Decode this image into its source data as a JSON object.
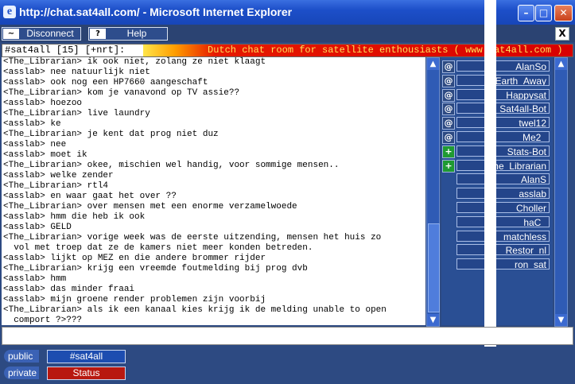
{
  "window": {
    "title": "http://chat.sat4all.com/ - Microsoft Internet Explorer",
    "title_icon": "ie-icon",
    "controls": [
      "minimize",
      "maximize",
      "close"
    ]
  },
  "toolbar": {
    "disconnect_label": "Disconnect",
    "disconnect_icon": "signal-icon",
    "help_label": "Help",
    "help_icon": "question-icon",
    "close_label": "X"
  },
  "topic": {
    "channel": "#sat4all [15] [+nrt]:",
    "text": "Dutch chat room for satellite enthousiasts ( www.sat4all.com )"
  },
  "chat": {
    "lines": [
      "<The_Librarian> ik ook niet, zolang ze niet klaagt",
      "<asslab> nee natuurlijk niet",
      "<asslab> ook nog een HP7660 aangeschaft",
      "<The_Librarian> kom je vanavond op TV assie??",
      "<asslab> hoezoo",
      "<The_Librarian> live laundry",
      "<asslab> ke",
      "<The_Librarian> je kent dat prog niet duz",
      "<asslab> nee",
      "<asslab> moet ik",
      "<The_Librarian> okee, mischien wel handig, voor sommige mensen..",
      "<asslab> welke zender",
      "<The_Librarian> rtl4",
      "<asslab> en waar gaat het over ??",
      "<The_Librarian> over mensen met een enorme verzamelwoede",
      "<asslab> hmm die heb ik ook",
      "<asslab> GELD",
      "<The_Librarian> vorige week was de eerste uitzending, mensen het huis zo",
      "  vol met troep dat ze de kamers niet meer konden betreden.",
      "<asslab> lijkt op MEZ en die andere brommer rijder",
      "<The_Librarian> krijg een vreemde foutmelding bij prog dvb",
      "<asslab> hmm",
      "<asslab> das minder fraai",
      "<asslab> mijn groene render problemen zijn voorbij",
      "<The_Librarian> als ik een kanaal kies krijg ik de melding unable to open",
      "  comport ?>???"
    ]
  },
  "users": [
    {
      "mode": "@",
      "nick": "AlanSo"
    },
    {
      "mode": "@",
      "nick": "Earth_Away"
    },
    {
      "mode": "@",
      "nick": "Happysat"
    },
    {
      "mode": "@",
      "nick": "Sat4all-Bot"
    },
    {
      "mode": "@",
      "nick": "twel12"
    },
    {
      "mode": "@",
      "nick": "_Me2_"
    },
    {
      "mode": "+",
      "nick": "Stats-Bot"
    },
    {
      "mode": "+",
      "nick": "The_Librarian"
    },
    {
      "mode": "",
      "nick": "AlanS"
    },
    {
      "mode": "",
      "nick": "asslab"
    },
    {
      "mode": "",
      "nick": "Choller"
    },
    {
      "mode": "",
      "nick": "haC_"
    },
    {
      "mode": "",
      "nick": "matchless"
    },
    {
      "mode": "",
      "nick": "Restor_nl"
    },
    {
      "mode": "",
      "nick": "ron_sat"
    }
  ],
  "input": {
    "value": ""
  },
  "tabs": {
    "public": {
      "side_label": "public",
      "tab_label": "#sat4all",
      "color": "#1d4db0"
    },
    "private": {
      "side_label": "private",
      "tab_label": "Status",
      "color": "#b81810"
    }
  },
  "colors": {
    "background": "#2d4a82",
    "titlebar": "#1d4fc9",
    "topic_banner_start": "#ffe54a",
    "topic_banner_end": "#d80000",
    "voice_badge": "#1f9a32"
  }
}
